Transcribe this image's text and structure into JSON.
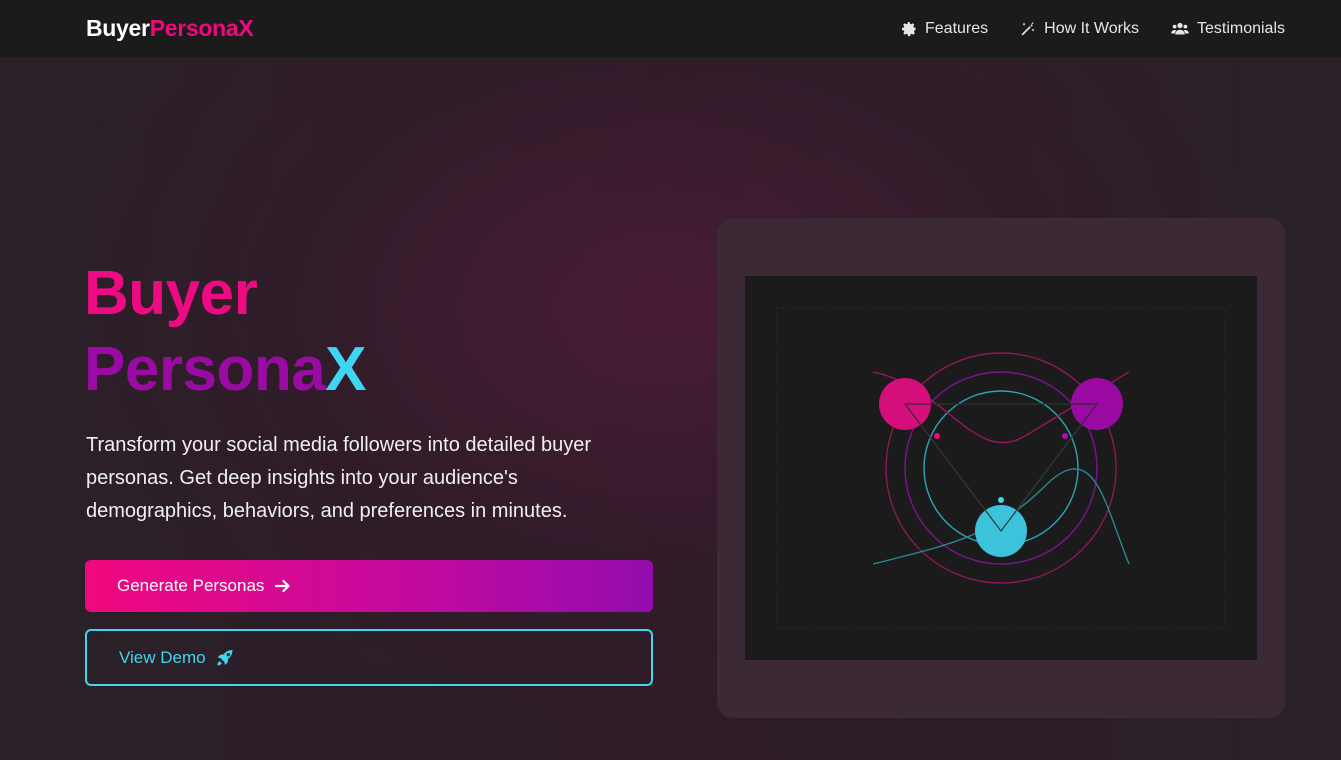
{
  "brand": {
    "part1": "Buyer",
    "part2": "PersonaX"
  },
  "nav": {
    "items": [
      {
        "label": "Features",
        "icon": "gear-icon"
      },
      {
        "label": "How It Works",
        "icon": "magic-wand-icon"
      },
      {
        "label": "Testimonials",
        "icon": "users-icon"
      }
    ]
  },
  "hero": {
    "title_line1": "Buyer",
    "title_line2_main": "Persona",
    "title_line2_accent": "X",
    "description": "Transform your social media followers into detailed buyer personas. Get deep insights into your audience's demographics, behaviors, and preferences in minutes.",
    "primary_button": "Generate Personas",
    "secondary_button": "View Demo"
  },
  "colors": {
    "pink": "#f0087e",
    "purple": "#9c0aa6",
    "cyan": "#3fd6f0",
    "nav_bg": "#1b1b1b",
    "card_bg": "#3b2935"
  },
  "icons": {
    "primary_button": "arrow-right-icon",
    "secondary_button": "rocket-icon"
  }
}
